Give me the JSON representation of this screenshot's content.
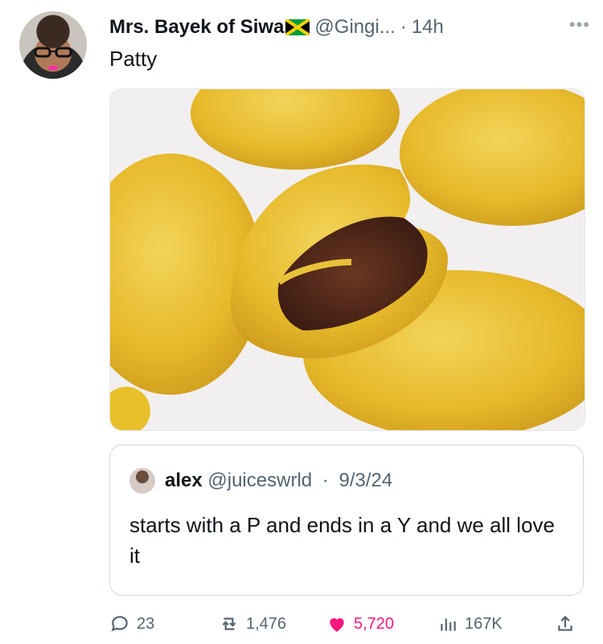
{
  "tweet": {
    "author_name": "Mrs. Bayek of Siwa",
    "handle": "@Gingi...",
    "separator": "·",
    "time": "14h",
    "more_icon": "more-horizontal-icon",
    "text": "Patty"
  },
  "quote": {
    "author_name": "alex",
    "handle": "@juiceswrld",
    "separator": "·",
    "date": "9/3/24",
    "text": "starts with a P and ends in a Y and we all love it"
  },
  "actions": {
    "replies": "23",
    "reposts": "1,476",
    "likes": "5,720",
    "views": "167K"
  },
  "colors": {
    "like": "#f91880",
    "muted": "#536471",
    "flag_green": "#009b3a",
    "flag_gold": "#fed100",
    "patty_yellow": "#e8c02a"
  }
}
